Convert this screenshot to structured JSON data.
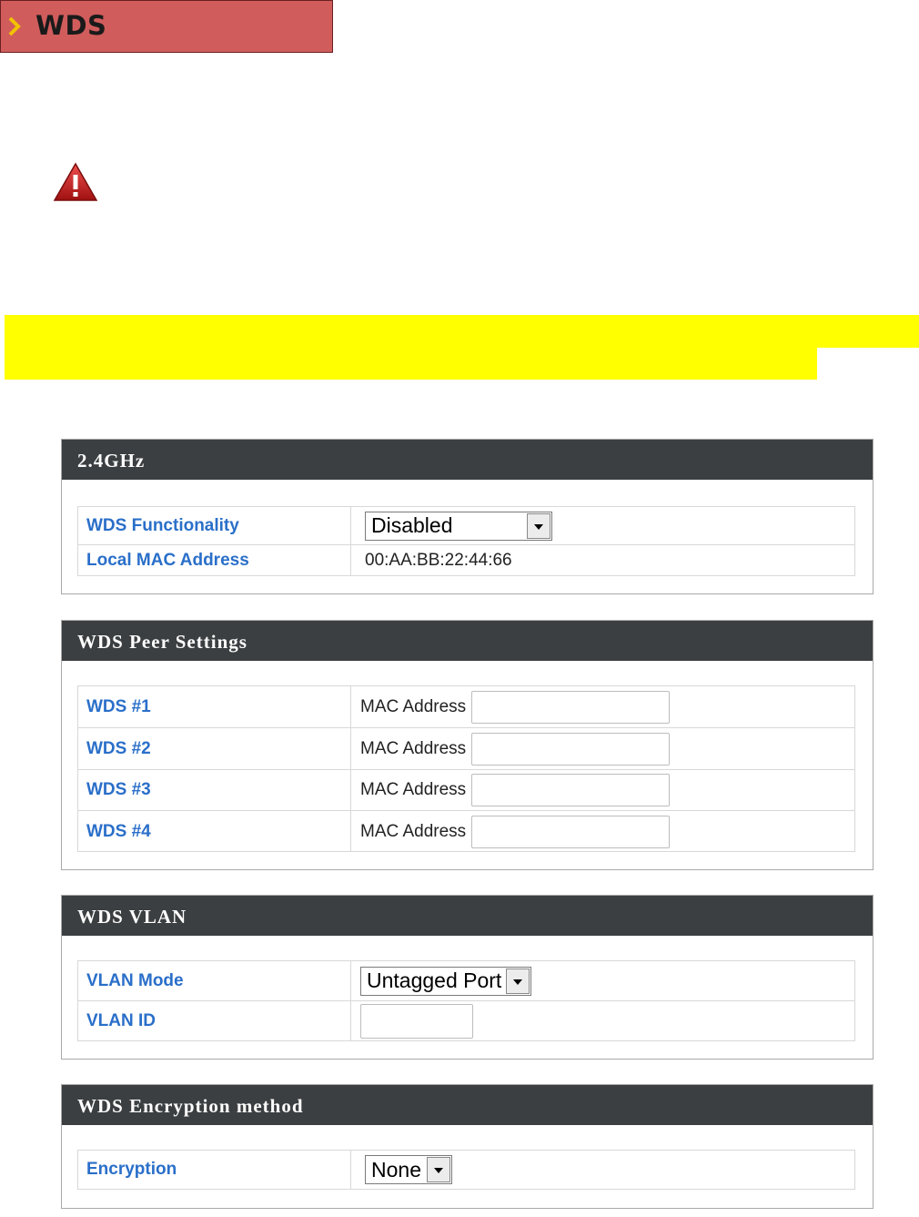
{
  "header": {
    "title": "WDS"
  },
  "panels": {
    "radio": {
      "title": "2.4GHz",
      "wds_functionality": {
        "label": "WDS Functionality",
        "value": "Disabled"
      },
      "local_mac": {
        "label": "Local MAC Address",
        "value": "00:AA:BB:22:44:66"
      }
    },
    "peer": {
      "title": "WDS Peer Settings",
      "rows": [
        {
          "label": "WDS #1",
          "field_label": "MAC Address",
          "value": ""
        },
        {
          "label": "WDS #2",
          "field_label": "MAC Address",
          "value": ""
        },
        {
          "label": "WDS #3",
          "field_label": "MAC Address",
          "value": ""
        },
        {
          "label": "WDS #4",
          "field_label": "MAC Address",
          "value": ""
        }
      ]
    },
    "vlan": {
      "title": "WDS VLAN",
      "mode": {
        "label": "VLAN Mode",
        "value": "Untagged Port"
      },
      "id": {
        "label": "VLAN ID",
        "value": ""
      }
    },
    "encryption": {
      "title": "WDS Encryption method",
      "method": {
        "label": "Encryption",
        "value": "None"
      }
    }
  },
  "colors": {
    "header_bg": "#d05c5c",
    "panel_head": "#3c3f41",
    "label_blue": "#2a6fc9",
    "highlight": "#ffff00"
  },
  "icons": {
    "header": "chevron-right-icon",
    "warning": "warning-icon"
  }
}
